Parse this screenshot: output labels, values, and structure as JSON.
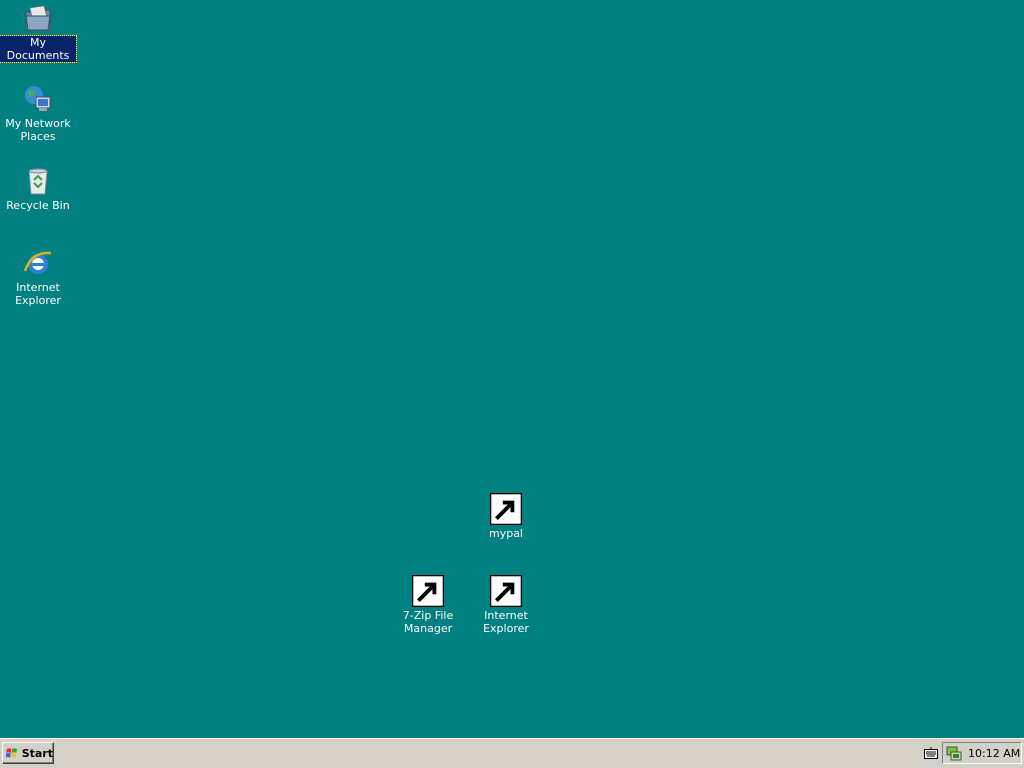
{
  "desktop": {
    "icons": [
      {
        "label": "My Documents"
      },
      {
        "label": "My Network Places"
      },
      {
        "label": "Recycle Bin"
      },
      {
        "label": "Internet Explorer"
      },
      {
        "label": "mypal"
      },
      {
        "label": "7-Zip File Manager"
      },
      {
        "label": "Internet Explorer"
      }
    ],
    "colors": {
      "background": "#008080",
      "selection": "#0a246a"
    }
  },
  "taskbar": {
    "start_label": "Start",
    "clock": "10:12 AM"
  }
}
